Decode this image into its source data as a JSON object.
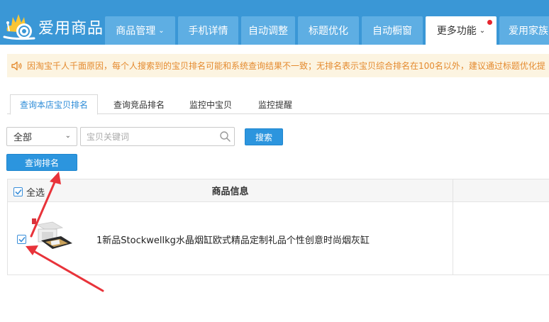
{
  "header": {
    "logo_text": "爱用商品",
    "nav": [
      {
        "label": "商品管理",
        "has_dropdown": true,
        "active": false
      },
      {
        "label": "手机详情",
        "has_dropdown": false,
        "active": false
      },
      {
        "label": "自动调整",
        "has_dropdown": false,
        "active": false
      },
      {
        "label": "标题优化",
        "has_dropdown": false,
        "active": false
      },
      {
        "label": "自动橱窗",
        "has_dropdown": false,
        "active": false
      },
      {
        "label": "更多功能",
        "has_dropdown": true,
        "active": true,
        "badge": "red-dot"
      },
      {
        "label": "爱用家族",
        "has_dropdown": false,
        "active": false
      }
    ]
  },
  "notice": {
    "icon": "speaker-icon",
    "text": "因淘宝千人千面原因，每个人搜索到的宝贝排名可能和系统查询结果不一致；无排名表示宝贝综合排名在100名以外，建议通过标题优化提"
  },
  "tabs": [
    {
      "label": "查询本店宝贝排名",
      "active": true
    },
    {
      "label": "查询竞品排名",
      "active": false
    },
    {
      "label": "监控中宝贝",
      "active": false
    },
    {
      "label": "监控提醒",
      "active": false
    }
  ],
  "filter": {
    "category_selected": "全部",
    "keyword_placeholder": "宝贝关键词",
    "keyword_value": "",
    "search_button": "搜索",
    "query_button": "查询排名"
  },
  "table": {
    "select_all_label": "全选",
    "columns": [
      "商品信息"
    ],
    "rows": [
      {
        "checked": true,
        "title": "1新品Stockwellkg水晶烟缸欧式精品定制礼品个性创意时尚烟灰缸"
      }
    ]
  },
  "colors": {
    "header_bg": "#3a97d6",
    "nav_bg": "#5eaee3",
    "accent": "#2c95de",
    "notice_bg": "#fcf4e1",
    "notice_text": "#e48a2e",
    "arrow": "#e8333a"
  }
}
